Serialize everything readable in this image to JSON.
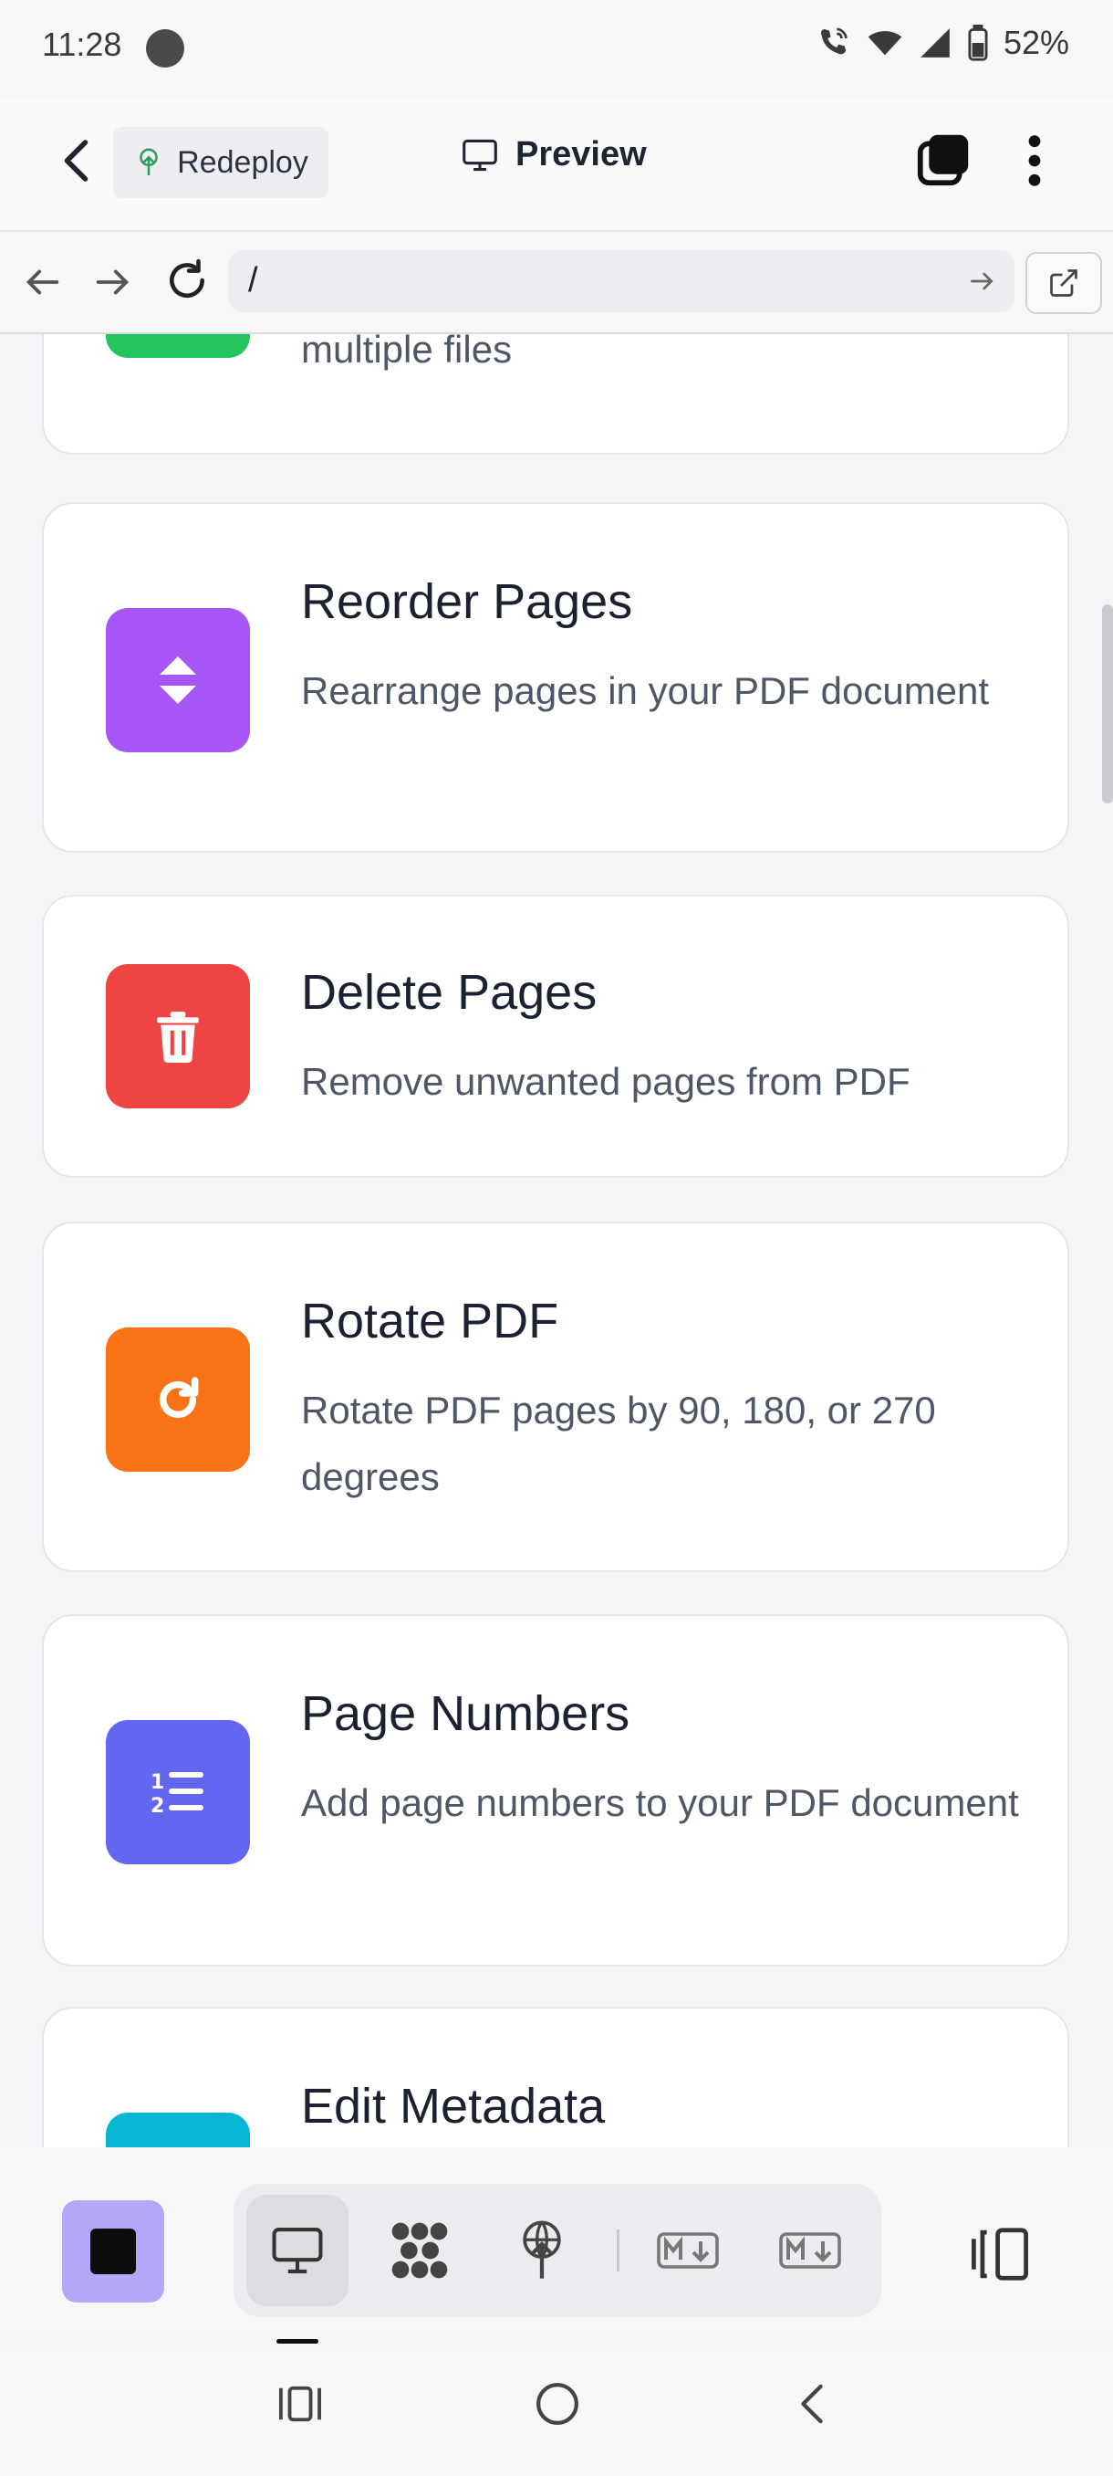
{
  "status_bar": {
    "time": "11:28",
    "battery": "52%",
    "icons": [
      "wifi-calling-icon",
      "wifi-icon",
      "signal-icon",
      "battery-icon"
    ]
  },
  "app_bar": {
    "redeploy_label": "Redeploy",
    "preview_label": "Preview"
  },
  "url_bar": {
    "url": "/"
  },
  "cards": [
    {
      "id": "merge-pdf",
      "title": "",
      "description": "multiple files",
      "icon": "merge-icon",
      "color": "#22c55e"
    },
    {
      "id": "reorder-pages",
      "title": "Reorder Pages",
      "description": "Rearrange pages in your PDF document",
      "icon": "reorder-icon",
      "color": "#a855f7"
    },
    {
      "id": "delete-pages",
      "title": "Delete Pages",
      "description": "Remove unwanted pages from PDF",
      "icon": "trash-icon",
      "color": "#ef4444"
    },
    {
      "id": "rotate-pdf",
      "title": "Rotate PDF",
      "description": "Rotate PDF pages by 90, 180, or 270 degrees",
      "icon": "rotate-icon",
      "color": "#f97316"
    },
    {
      "id": "page-numbers",
      "title": "Page Numbers",
      "description": "Add page numbers to your PDF document",
      "icon": "numbered-list-icon",
      "color": "#6366f1"
    },
    {
      "id": "edit-metadata",
      "title": "Edit Metadata",
      "description": "",
      "icon": "metadata-icon",
      "color": "#06b6d4"
    }
  ],
  "toolbar": {
    "items": [
      "monitor-icon",
      "graph-icon",
      "deploy-icon",
      "markdown-icon",
      "markdown-icon",
      "panel-toggle-icon"
    ],
    "accent": "#b4a7f7"
  }
}
